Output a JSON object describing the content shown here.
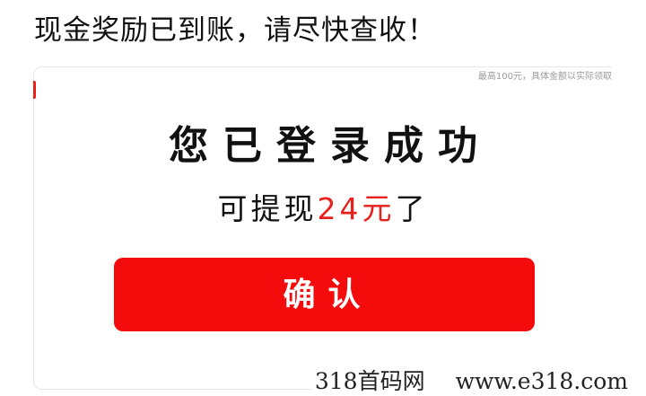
{
  "headline": "现金奖励已到账，请尽快查收！",
  "dialog": {
    "note": "最高100元，具体金额以实际领取",
    "title": "您已登录成功",
    "subtitle": {
      "prefix": "可提现",
      "amount": "24元",
      "suffix": "了"
    },
    "confirm_label": "确认"
  },
  "watermark": {
    "brand": "318首码网",
    "url": "www.e318.com"
  },
  "colors": {
    "accent": "#f40b0b",
    "amount_red": "#e8201c",
    "text": "#111111",
    "note_gray": "#9a9a9a"
  }
}
